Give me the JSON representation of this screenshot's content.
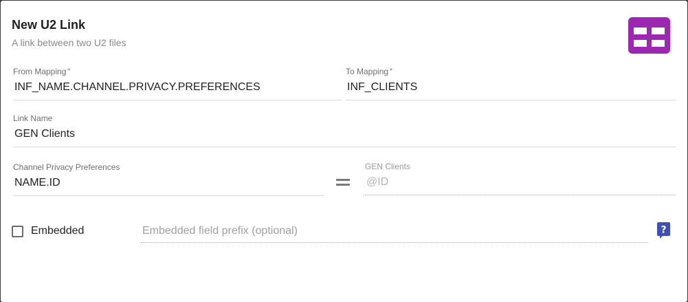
{
  "dialog": {
    "title": "New U2 Link",
    "subtitle": "A link between two U2 files",
    "app_icon": "grid-layout-icon",
    "accent_color": "#9c27b0"
  },
  "form": {
    "from_mapping": {
      "label": "From Mapping",
      "required_mark": "*",
      "value": "INF_NAME.CHANNEL.PRIVACY.PREFERENCES"
    },
    "to_mapping": {
      "label": "To Mapping",
      "required_mark": "*",
      "value": "INF_CLIENTS"
    },
    "link_name": {
      "label": "Link Name",
      "value": "GEN Clients"
    },
    "source_key": {
      "label": "Channel Privacy Preferences",
      "value": "NAME.ID"
    },
    "equals_symbol": "=",
    "target_key": {
      "label": "GEN Clients",
      "value": "@ID"
    },
    "embedded": {
      "label": "Embedded",
      "checked": false
    },
    "embedded_prefix": {
      "placeholder": "Embedded field prefix (optional)",
      "value": ""
    },
    "help_icon": "question-help-icon",
    "help_color": "#3f51b5"
  }
}
